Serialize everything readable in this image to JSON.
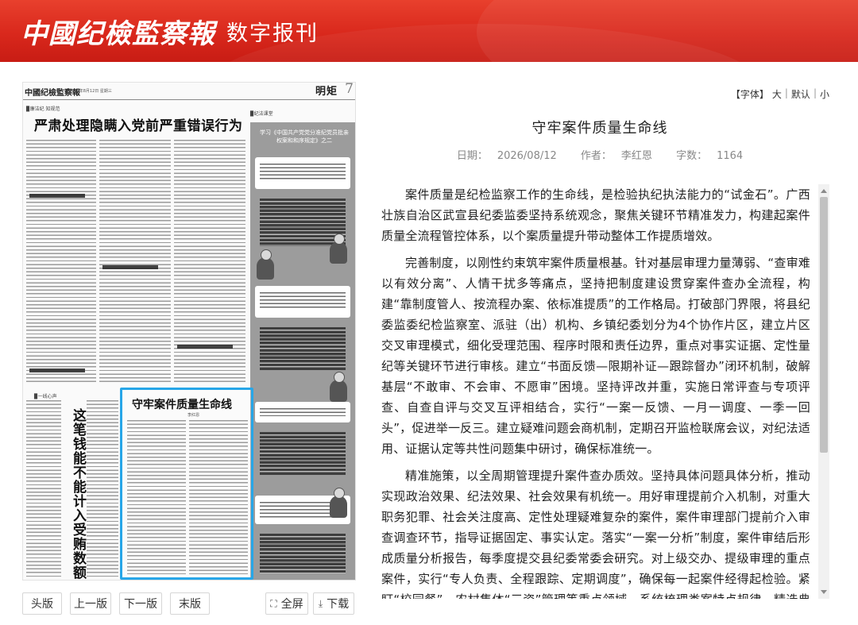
{
  "header": {
    "logo_main": "中國纪檢監察報",
    "logo_sub": "数字报刊"
  },
  "paper": {
    "masthead": "中國纪檢監察報",
    "date_line": "2026年8月12日  星期三",
    "section_name": "明矩",
    "page_number": "7",
    "tag_left": "▉廉洁纪 知规范",
    "tag_right": "▉纪法课堂",
    "tag_vertical": "▉一线心声",
    "headline": "严肃处理隐瞒入党前严重错误行为",
    "side_panel_title": "学习《中国共产党党分准纪党员批亲权案和和序规定》之二",
    "vertical_headline": "这笔钱能不能计入受贿数额",
    "highlight_title": "守牢案件质量生命线",
    "highlight_author": "李红恩"
  },
  "controls": {
    "first": "头版",
    "prev": "上一版",
    "next": "下一版",
    "last": "末版",
    "fullscreen": "全屏",
    "download": "下载"
  },
  "font_controls": {
    "label": "【字体】",
    "large": "大",
    "default": "默认",
    "small": "小",
    "sep": "|"
  },
  "article": {
    "title": "守牢案件质量生命线",
    "date_label": "日期：",
    "date": "2026/08/12",
    "author_label": "作者：",
    "author": "李红恩",
    "words_label": "字数：",
    "words": "1164",
    "paragraphs": [
      "案件质量是纪检监察工作的生命线，是检验执纪执法能力的“试金石”。广西壮族自治区武宣县纪委监委坚持系统观念，聚焦关键环节精准发力，构建起案件质量全流程管控体系，以个案质量提升带动整体工作提质增效。",
      "完善制度，以刚性约束筑牢案件质量根基。针对基层审理力量薄弱、“查审难以有效分离”、人情干扰多等痛点，坚持把制度建设贯穿案件查办全流程，构建“靠制度管人、按流程办案、依标准提质”的工作格局。打破部门界限，将县纪委监委纪检监察室、派驻（出）机构、乡镇纪委划分为4个协作片区，建立片区交叉审理模式，细化受理范围、程序时限和责任边界，重点对事实证据、定性量纪等关键环节进行审核。建立“书面反馈—限期补证—跟踪督办”闭环机制，破解基层“不敢审、不会审、不愿审”困境。坚持评改并重，实施日常评查与专项评查、自查自评与交叉互评相结合，实行“一案一反馈、一月一调度、一季一回头”，促进举一反三。建立疑难问题会商机制，定期召开监检联席会议，对纪法适用、证据认定等共性问题集中研讨，确保标准统一。",
      "精准施策，以全周期管理提升案件查办质效。坚持具体问题具体分析，推动实现政治效果、纪法效果、社会效果有机统一。用好审理提前介入机制，对重大职务犯罪、社会关注度高、定性处理疑难复杂的案件，案件审理部门提前介入审查调查环节，指导证据固定、事实认定。落实“一案一分析”制度，案件审结后形成质量分析报告，每季度提交县纪委常委会研究。对上级交办、提级审理的重点案件，实行“专人负责、全程跟踪、定期调度”，确保每一起案件经得起检验。紧盯“校园餐”、农村集体“三资”管理等重点领域，系统梳理类案特点规律，精选典型案例作为指导性案例汇编。针对评查发现的普遍性、多发性问题，分类梳理“共性问题清单”，开展集中整治，推动同类问题系统性规范。"
    ]
  },
  "colors": {
    "banner_red": "#d9281c",
    "highlight_blue": "#27a6e8"
  },
  "icons": {
    "fullscreen": "fullscreen-icon",
    "download": "download-icon"
  }
}
